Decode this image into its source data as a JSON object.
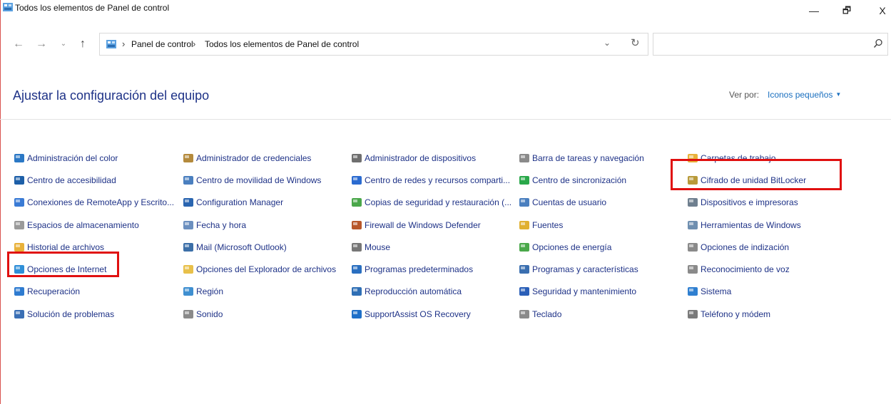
{
  "window": {
    "title": "Todos los elementos de Panel de control",
    "minimize_glyph": "—",
    "maximize_glyph": "🗗",
    "close_glyph": "X"
  },
  "navigation": {
    "back_icon": "arrow-left-icon",
    "forward_icon": "arrow-right-icon",
    "recent_icon": "chevron-down-icon",
    "up_icon": "arrow-up-icon",
    "back_glyph": "←",
    "forward_glyph": "→",
    "recent_glyph": "⌄",
    "up_glyph": "↑"
  },
  "address": {
    "separator": "›",
    "crumbs": [
      "Panel de control",
      "Todos los elementos de Panel de control"
    ],
    "dropdown_glyph": "⌄",
    "refresh_glyph": "↻"
  },
  "search": {
    "placeholder": "",
    "icon": "search-icon"
  },
  "header": {
    "title": "Ajustar la configuración del equipo",
    "view_by_label": "Ver por:",
    "view_by_value": "Iconos pequeños",
    "view_by_arrow": "▼"
  },
  "items": {
    "col1": [
      {
        "label": "Administración del color",
        "icon": "color-management-icon",
        "color": "#2b78c5"
      },
      {
        "label": "Centro de accesibilidad",
        "icon": "accessibility-icon",
        "color": "#1d5fa8"
      },
      {
        "label": "Conexiones de RemoteApp y Escrito...",
        "icon": "remoteapp-icon",
        "color": "#3a7bd5"
      },
      {
        "label": "Espacios de almacenamiento",
        "icon": "storage-spaces-icon",
        "color": "#9a9a9a"
      },
      {
        "label": "Historial de archivos",
        "icon": "file-history-icon",
        "color": "#e8b13a"
      },
      {
        "label": "Opciones de Internet",
        "icon": "internet-options-icon",
        "color": "#2f8fd8"
      },
      {
        "label": "Recuperación",
        "icon": "recovery-icon",
        "color": "#2e7bd0"
      },
      {
        "label": "Solución de problemas",
        "icon": "troubleshooting-icon",
        "color": "#3a6fb5"
      }
    ],
    "col2": [
      {
        "label": "Administrador de credenciales",
        "icon": "credential-manager-icon",
        "color": "#b48a3c"
      },
      {
        "label": "Centro de movilidad de Windows",
        "icon": "mobility-center-icon",
        "color": "#4a7fbf"
      },
      {
        "label": "Configuration Manager",
        "icon": "configuration-manager-icon",
        "color": "#2a65b0"
      },
      {
        "label": "Fecha y hora",
        "icon": "date-time-icon",
        "color": "#6b8fbf"
      },
      {
        "label": "Mail (Microsoft Outlook)",
        "icon": "mail-icon",
        "color": "#3c6fa8"
      },
      {
        "label": "Opciones del Explorador de archivos",
        "icon": "file-explorer-options-icon",
        "color": "#e8c04a"
      },
      {
        "label": "Región",
        "icon": "region-icon",
        "color": "#3f8fd0"
      },
      {
        "label": "Sonido",
        "icon": "sound-icon",
        "color": "#8a8a8a"
      }
    ],
    "col3": [
      {
        "label": "Administrador de dispositivos",
        "icon": "device-manager-icon",
        "color": "#6f6f6f"
      },
      {
        "label": "Centro de redes y recursos comparti...",
        "icon": "network-center-icon",
        "color": "#2b6bd0"
      },
      {
        "label": "Copias de seguridad y restauración (...",
        "icon": "backup-restore-icon",
        "color": "#4aa74a"
      },
      {
        "label": "Firewall de Windows Defender",
        "icon": "firewall-icon",
        "color": "#b8572a"
      },
      {
        "label": "Mouse",
        "icon": "mouse-icon",
        "color": "#777777"
      },
      {
        "label": "Programas predeterminados",
        "icon": "default-programs-icon",
        "color": "#2a6fc0"
      },
      {
        "label": "Reproducción automática",
        "icon": "autoplay-icon",
        "color": "#2f6fb5"
      },
      {
        "label": "SupportAssist OS Recovery",
        "icon": "supportassist-icon",
        "color": "#1e6fc8"
      }
    ],
    "col4": [
      {
        "label": "Barra de tareas y navegación",
        "icon": "taskbar-icon",
        "color": "#8a8a8a"
      },
      {
        "label": "Centro de sincronización",
        "icon": "sync-center-icon",
        "color": "#2aa84a"
      },
      {
        "label": "Cuentas de usuario",
        "icon": "user-accounts-icon",
        "color": "#4a7fbf"
      },
      {
        "label": "Fuentes",
        "icon": "fonts-icon",
        "color": "#e0b030"
      },
      {
        "label": "Opciones de energía",
        "icon": "power-options-icon",
        "color": "#4aa84a"
      },
      {
        "label": "Programas y características",
        "icon": "programs-features-icon",
        "color": "#3a6fb0"
      },
      {
        "label": "Seguridad y mantenimiento",
        "icon": "security-maintenance-icon",
        "color": "#2a5fb8"
      },
      {
        "label": "Teclado",
        "icon": "keyboard-icon",
        "color": "#8a8a8a"
      }
    ],
    "col5": [
      {
        "label": "Carpetas de trabajo",
        "icon": "work-folders-icon",
        "color": "#e8b13a"
      },
      {
        "label": "Cifrado de unidad BitLocker",
        "icon": "bitlocker-icon",
        "color": "#b89a3a"
      },
      {
        "label": "Dispositivos e impresoras",
        "icon": "devices-printers-icon",
        "color": "#6f7f8f"
      },
      {
        "label": "Herramientas de Windows",
        "icon": "windows-tools-icon",
        "color": "#6f8fb0"
      },
      {
        "label": "Opciones de indización",
        "icon": "indexing-options-icon",
        "color": "#8a8a8a"
      },
      {
        "label": "Reconocimiento de voz",
        "icon": "speech-recognition-icon",
        "color": "#8a8a8a"
      },
      {
        "label": "Sistema",
        "icon": "system-icon",
        "color": "#2f7fd0"
      },
      {
        "label": "Teléfono y módem",
        "icon": "phone-modem-icon",
        "color": "#7a7a7a"
      }
    ]
  },
  "highlights": {
    "color": "#e01010",
    "targets": [
      "Cifrado de unidad BitLocker",
      "Opciones de Internet"
    ]
  }
}
